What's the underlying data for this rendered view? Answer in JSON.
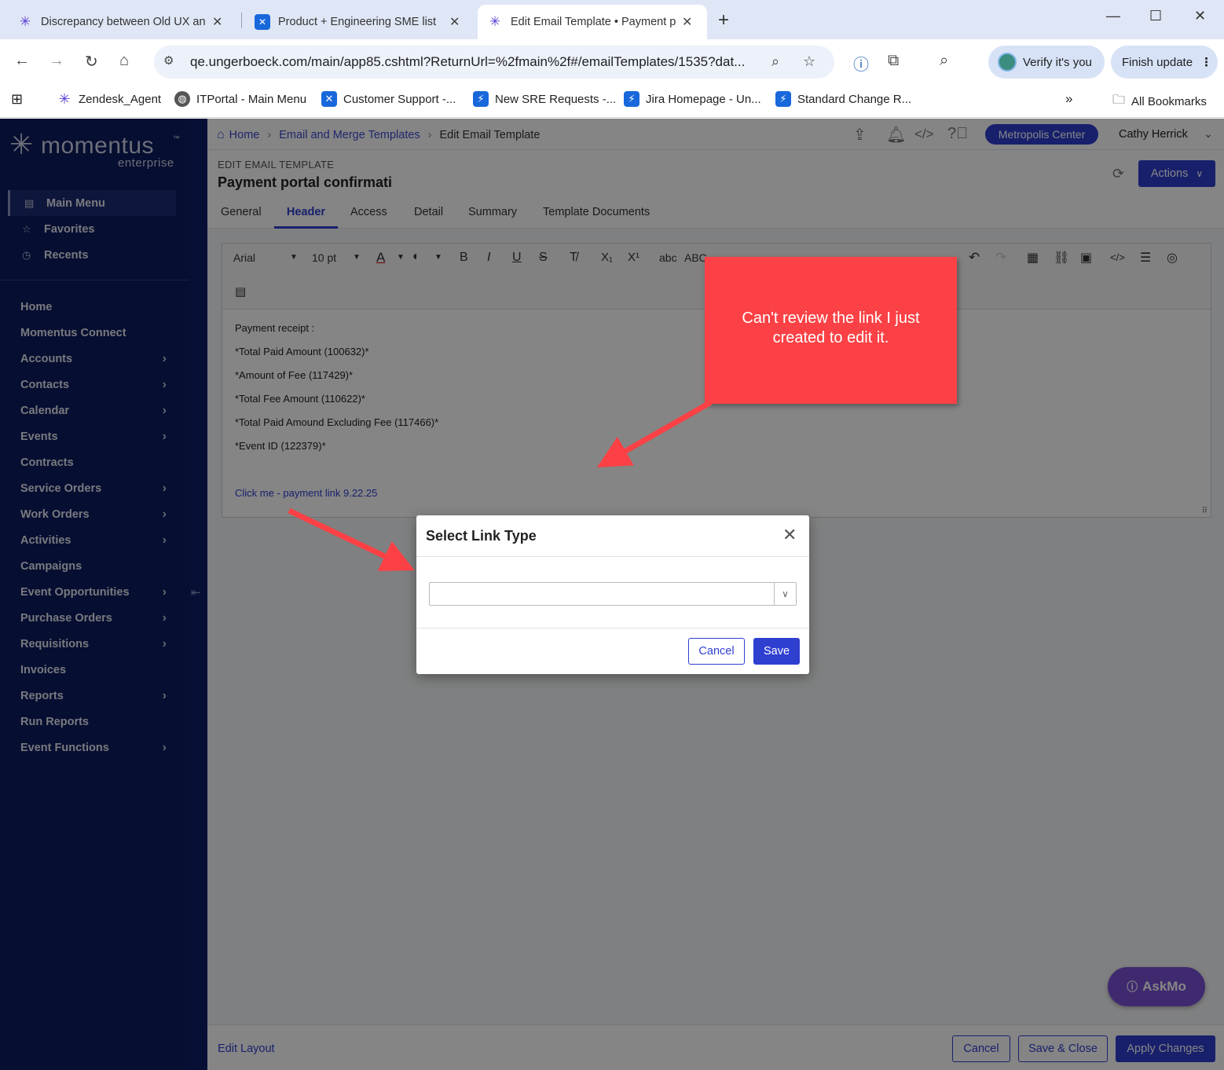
{
  "browser": {
    "tabs": [
      {
        "title": "Discrepancy between Old UX an",
        "icon": "asterisk-icon"
      },
      {
        "title": "Product + Engineering SME list",
        "icon": "confluence-icon"
      },
      {
        "title": "Edit Email Template • Payment p",
        "icon": "asterisk-icon"
      }
    ],
    "url": "qe.ungerboeck.com/main/app85.cshtml?ReturnUrl=%2fmain%2f#/emailTemplates/1535?dat...",
    "verify_label": "Verify it's you",
    "finish_label": "Finish update",
    "bookmarks": [
      {
        "label": "Zendesk_Agent"
      },
      {
        "label": "ITPortal - Main Menu"
      },
      {
        "label": "Customer Support -..."
      },
      {
        "label": "New SRE Requests -..."
      },
      {
        "label": "Jira Homepage - Un..."
      },
      {
        "label": "Standard Change R..."
      }
    ],
    "all_bookmarks": "All Bookmarks"
  },
  "logo": {
    "name": "momentus",
    "sub": "enterprise",
    "tm": "™"
  },
  "sidebar": {
    "top": [
      {
        "label": "Main Menu"
      },
      {
        "label": "Favorites"
      },
      {
        "label": "Recents"
      }
    ],
    "menu": [
      {
        "label": "Home",
        "chevron": false
      },
      {
        "label": "Momentus Connect",
        "chevron": false
      },
      {
        "label": "Accounts",
        "chevron": true
      },
      {
        "label": "Contacts",
        "chevron": true
      },
      {
        "label": "Calendar",
        "chevron": true
      },
      {
        "label": "Events",
        "chevron": true
      },
      {
        "label": "Contracts",
        "chevron": false
      },
      {
        "label": "Service Orders",
        "chevron": true
      },
      {
        "label": "Work Orders",
        "chevron": true
      },
      {
        "label": "Activities",
        "chevron": true
      },
      {
        "label": "Campaigns",
        "chevron": false
      },
      {
        "label": "Event Opportunities",
        "chevron": true
      },
      {
        "label": "Purchase Orders",
        "chevron": true
      },
      {
        "label": "Requisitions",
        "chevron": true
      },
      {
        "label": "Invoices",
        "chevron": false
      },
      {
        "label": "Reports",
        "chevron": true
      },
      {
        "label": "Run Reports",
        "chevron": false
      },
      {
        "label": "Event Functions",
        "chevron": true
      }
    ]
  },
  "breadcrumb": {
    "home": "Home",
    "parent": "Email and Merge Templates",
    "current": "Edit Email Template"
  },
  "header": {
    "venue": "Metropolis Center",
    "user": "Cathy Herrick",
    "label": "EDIT EMAIL TEMPLATE",
    "title": "Payment portal confirmati",
    "actions": "Actions"
  },
  "tabs": [
    {
      "label": "General"
    },
    {
      "label": "Header"
    },
    {
      "label": "Access"
    },
    {
      "label": "Detail"
    },
    {
      "label": "Summary"
    },
    {
      "label": "Template Documents"
    }
  ],
  "toolbar": {
    "font": "Arial",
    "size": "10 pt",
    "bold": "B",
    "italic": "I",
    "underline": "U",
    "strike": "S",
    "lowercase": "abc",
    "uppercase": "ABC"
  },
  "editor": {
    "lines": [
      "Payment receipt :",
      "*Total Paid Amount (100632)*",
      "*Amount of Fee (117429)*",
      "*Total Fee Amount (110622)*",
      "*Total Paid Amound Excluding Fee (117466)*",
      "*Event ID (122379)*"
    ],
    "link": "Click me - payment link 9.22.25"
  },
  "footer": {
    "edit_layout": "Edit Layout",
    "cancel": "Cancel",
    "save_close": "Save & Close",
    "apply": "Apply Changes"
  },
  "askmo": "AskMo",
  "modal": {
    "title": "Select Link Type",
    "select_value": "",
    "cancel": "Cancel",
    "save": "Save"
  },
  "annotation": {
    "text": "Can't review the link I just created to edit it."
  }
}
